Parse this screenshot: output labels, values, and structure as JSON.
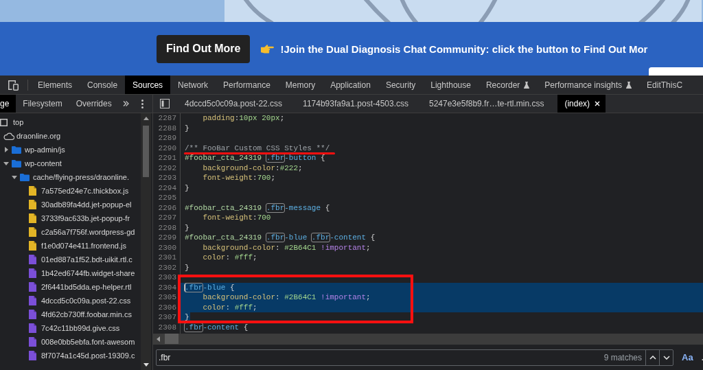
{
  "banner": {
    "button": "Find Out More",
    "message": "!Join the Dual Diagnosis Chat Community: click the button to Find Out Mor"
  },
  "main_tabs": [
    {
      "label": "Elements",
      "selected": false,
      "experimental": false
    },
    {
      "label": "Console",
      "selected": false,
      "experimental": false
    },
    {
      "label": "Sources",
      "selected": true,
      "experimental": false
    },
    {
      "label": "Network",
      "selected": false,
      "experimental": false
    },
    {
      "label": "Performance",
      "selected": false,
      "experimental": false
    },
    {
      "label": "Memory",
      "selected": false,
      "experimental": false
    },
    {
      "label": "Application",
      "selected": false,
      "experimental": false
    },
    {
      "label": "Security",
      "selected": false,
      "experimental": false
    },
    {
      "label": "Lighthouse",
      "selected": false,
      "experimental": false
    },
    {
      "label": "Recorder",
      "selected": false,
      "experimental": true
    },
    {
      "label": "Performance insights",
      "selected": false,
      "experimental": true
    },
    {
      "label": "EditThisC",
      "selected": false,
      "experimental": false
    }
  ],
  "navigator_tabs": [
    {
      "label": "ge",
      "selected": true
    },
    {
      "label": "Filesystem",
      "selected": false
    },
    {
      "label": "Overrides",
      "selected": false
    }
  ],
  "editor_tabs": [
    {
      "label": "4dccd5c0c09a.post-22.css",
      "selected": false
    },
    {
      "label": "1174b93fa9a1.post-4503.css",
      "selected": false
    },
    {
      "label": "5247e3e5f8b9.fr…te-rtl.min.css",
      "selected": false
    },
    {
      "label": "(index)",
      "selected": true
    }
  ],
  "file_tree": [
    {
      "label": "top",
      "kind": "frame",
      "children": [
        {
          "label": "draonline.org",
          "kind": "domain",
          "children": [
            {
              "label": "wp-admin/js",
              "kind": "folder",
              "expanded": false
            },
            {
              "label": "wp-content",
              "kind": "folder",
              "expanded": true,
              "children": [
                {
                  "label": "cache/flying-press/draonline.",
                  "kind": "folder",
                  "expanded": true,
                  "children": [
                    {
                      "label": "7a575ed24e7c.thickbox.js",
                      "kind": "script"
                    },
                    {
                      "label": "30adb89fa4dd.jet-popup-el",
                      "kind": "script"
                    },
                    {
                      "label": "3733f9ac633b.jet-popup-fr",
                      "kind": "script"
                    },
                    {
                      "label": "c2a56a7f756f.wordpress-gd",
                      "kind": "script"
                    },
                    {
                      "label": "f1e0d074e411.frontend.js",
                      "kind": "script"
                    },
                    {
                      "label": "01ed887a1f52.bdt-uikit.rtl.c",
                      "kind": "stylesheet"
                    },
                    {
                      "label": "1b42ed6744fb.widget-share",
                      "kind": "stylesheet"
                    },
                    {
                      "label": "2f6441bd5dda.ep-helper.rtl",
                      "kind": "stylesheet"
                    },
                    {
                      "label": "4dccd5c0c09a.post-22.css",
                      "kind": "stylesheet"
                    },
                    {
                      "label": "4fd62cb730ff.foobar.min.cs",
                      "kind": "stylesheet"
                    },
                    {
                      "label": "7c42c11bb99d.give.css",
                      "kind": "stylesheet"
                    },
                    {
                      "label": "008e0bb5ebfa.font-awesom",
                      "kind": "stylesheet"
                    },
                    {
                      "label": "8f7074a1c45d.post-19309.c",
                      "kind": "stylesheet"
                    }
                  ]
                }
              ]
            }
          ]
        }
      ]
    }
  ],
  "code_lines": [
    {
      "number": "2287",
      "selected": false,
      "caret": false,
      "tokens": [
        {
          "kind": "property",
          "text": "    padding"
        },
        {
          "kind": "plain",
          "text": ":"
        },
        {
          "kind": "value",
          "text": "10px 20px"
        },
        {
          "kind": "plain",
          "text": ";"
        }
      ]
    },
    {
      "number": "2288",
      "selected": false,
      "caret": false,
      "tokens": [
        {
          "kind": "plain",
          "text": "}"
        }
      ]
    },
    {
      "number": "2289",
      "selected": false,
      "caret": false
    },
    {
      "number": "2290",
      "selected": false,
      "caret": false,
      "tokens": [
        {
          "kind": "comment",
          "text": "/** FooBar Custom CSS Styles **/"
        }
      ]
    },
    {
      "number": "2291",
      "selected": false,
      "caret": false,
      "tokens": [
        {
          "kind": "selector",
          "text": "#foobar_cta_24319 "
        },
        {
          "kind": "match",
          "text": ".fbr"
        },
        {
          "kind": "class",
          "text": "-button"
        },
        {
          "kind": "plain",
          "text": " {"
        }
      ]
    },
    {
      "number": "2292",
      "selected": false,
      "caret": false,
      "tokens": [
        {
          "kind": "property",
          "text": "    background-color"
        },
        {
          "kind": "plain",
          "text": ":"
        },
        {
          "kind": "value",
          "text": "#222"
        },
        {
          "kind": "plain",
          "text": ";"
        }
      ]
    },
    {
      "number": "2293",
      "selected": false,
      "caret": false,
      "tokens": [
        {
          "kind": "property",
          "text": "    font-weight"
        },
        {
          "kind": "plain",
          "text": ":"
        },
        {
          "kind": "value",
          "text": "700"
        },
        {
          "kind": "plain",
          "text": ";"
        }
      ]
    },
    {
      "number": "2294",
      "selected": false,
      "caret": false,
      "tokens": [
        {
          "kind": "plain",
          "text": "}"
        }
      ]
    },
    {
      "number": "2295",
      "selected": false,
      "caret": false
    },
    {
      "number": "2296",
      "selected": false,
      "caret": false,
      "tokens": [
        {
          "kind": "selector",
          "text": "#foobar_cta_24319 "
        },
        {
          "kind": "match",
          "text": ".fbr"
        },
        {
          "kind": "class",
          "text": "-message"
        },
        {
          "kind": "plain",
          "text": " {"
        }
      ]
    },
    {
      "number": "2297",
      "selected": false,
      "caret": false,
      "tokens": [
        {
          "kind": "property",
          "text": "    font-weight"
        },
        {
          "kind": "plain",
          "text": ":"
        },
        {
          "kind": "value",
          "text": "700"
        }
      ]
    },
    {
      "number": "2298",
      "selected": false,
      "caret": false,
      "tokens": [
        {
          "kind": "plain",
          "text": "}"
        }
      ]
    },
    {
      "number": "2299",
      "selected": false,
      "caret": false,
      "tokens": [
        {
          "kind": "selector",
          "text": "#foobar_cta_24319 "
        },
        {
          "kind": "match",
          "text": ".fbr"
        },
        {
          "kind": "class",
          "text": "-blue "
        },
        {
          "kind": "match",
          "text": ".fbr"
        },
        {
          "kind": "class",
          "text": "-content"
        },
        {
          "kind": "plain",
          "text": " {"
        }
      ]
    },
    {
      "number": "2300",
      "selected": false,
      "caret": false,
      "tokens": [
        {
          "kind": "property",
          "text": "    background-color"
        },
        {
          "kind": "plain",
          "text": ": "
        },
        {
          "kind": "value",
          "text": "#2B64C1"
        },
        {
          "kind": "important",
          "text": " !important"
        },
        {
          "kind": "plain",
          "text": ";"
        }
      ]
    },
    {
      "number": "2301",
      "selected": false,
      "caret": false,
      "tokens": [
        {
          "kind": "property",
          "text": "    color"
        },
        {
          "kind": "plain",
          "text": ": "
        },
        {
          "kind": "value",
          "text": "#fff"
        },
        {
          "kind": "plain",
          "text": ";"
        }
      ]
    },
    {
      "number": "2302",
      "selected": false,
      "caret": false,
      "tokens": [
        {
          "kind": "plain",
          "text": "}"
        }
      ]
    },
    {
      "number": "2303",
      "selected": false,
      "caret": false
    },
    {
      "number": "2304",
      "selected": true,
      "caret": true,
      "tokens": [
        {
          "kind": "match",
          "text": ".fbr"
        },
        {
          "kind": "class",
          "text": "-blue"
        },
        {
          "kind": "plain",
          "text": " {"
        }
      ]
    },
    {
      "number": "2305",
      "selected": true,
      "caret": false,
      "tokens": [
        {
          "kind": "property",
          "text": "    background-color"
        },
        {
          "kind": "plain",
          "text": ": "
        },
        {
          "kind": "value",
          "text": "#2B64C1"
        },
        {
          "kind": "important",
          "text": " !important"
        },
        {
          "kind": "plain",
          "text": ";"
        }
      ]
    },
    {
      "number": "2306",
      "selected": true,
      "caret": false,
      "tokens": [
        {
          "kind": "property",
          "text": "    color"
        },
        {
          "kind": "plain",
          "text": ": "
        },
        {
          "kind": "value",
          "text": "#fff"
        },
        {
          "kind": "plain",
          "text": ";"
        }
      ]
    },
    {
      "number": "2307",
      "selected": true,
      "caret": false,
      "tokens": [
        {
          "kind": "plain",
          "text": "}"
        }
      ]
    },
    {
      "number": "2308",
      "selected": false,
      "caret": false,
      "tokens": [
        {
          "kind": "match",
          "text": ".fbr"
        },
        {
          "kind": "class",
          "text": "-content"
        },
        {
          "kind": "plain",
          "text": " {"
        }
      ]
    }
  ],
  "search": {
    "value": ".fbr",
    "matches": "9 matches",
    "case_button": {
      "label": "Aa",
      "selected": true
    },
    "regex_button": "."
  }
}
